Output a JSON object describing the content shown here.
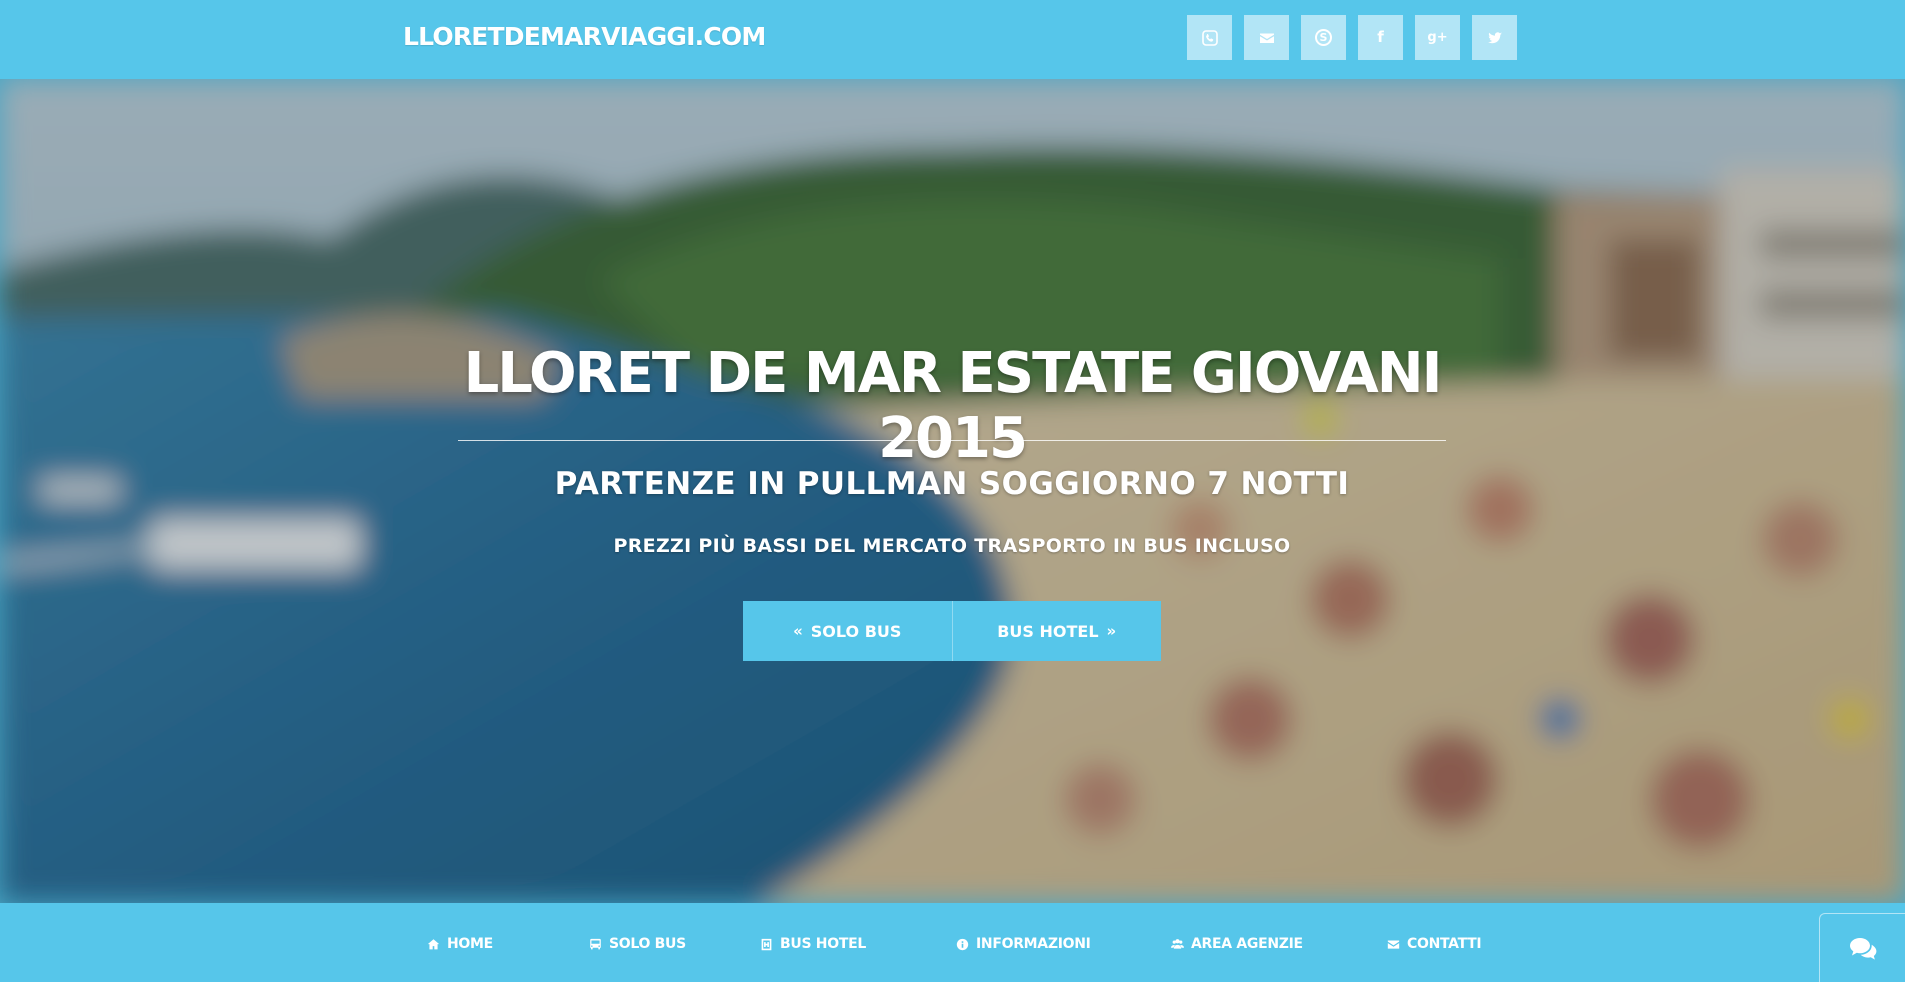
{
  "header": {
    "brand": "LLORETDEMARVIAGGI.COM",
    "social": [
      {
        "name": "phone-icon"
      },
      {
        "name": "envelope-icon"
      },
      {
        "name": "skype-icon"
      },
      {
        "name": "facebook-icon"
      },
      {
        "name": "google-plus-icon"
      },
      {
        "name": "twitter-icon"
      }
    ]
  },
  "hero": {
    "title": "LLORET DE MAR ESTATE GIOVANI 2015",
    "subtitle": "PARTENZE IN PULLMAN SOGGIORNO 7 NOTTI",
    "tagline": "PREZZI PIÙ BASSI DEL MERCATO TRASPORTO IN BUS INCLUSO",
    "buttons": {
      "solo_bus": "SOLO BUS",
      "bus_hotel": "BUS HOTEL"
    }
  },
  "nav": {
    "items": [
      {
        "label": "HOME",
        "icon": "home-icon"
      },
      {
        "label": "SOLO BUS",
        "icon": "bus-icon"
      },
      {
        "label": "BUS HOTEL",
        "icon": "hotel-icon"
      },
      {
        "label": "INFORMAZIONI",
        "icon": "info-icon"
      },
      {
        "label": "AREA AGENZIE",
        "icon": "users-icon"
      },
      {
        "label": "CONTATTI",
        "icon": "envelope-icon"
      }
    ]
  },
  "colors": {
    "accent": "#56c6ea"
  }
}
